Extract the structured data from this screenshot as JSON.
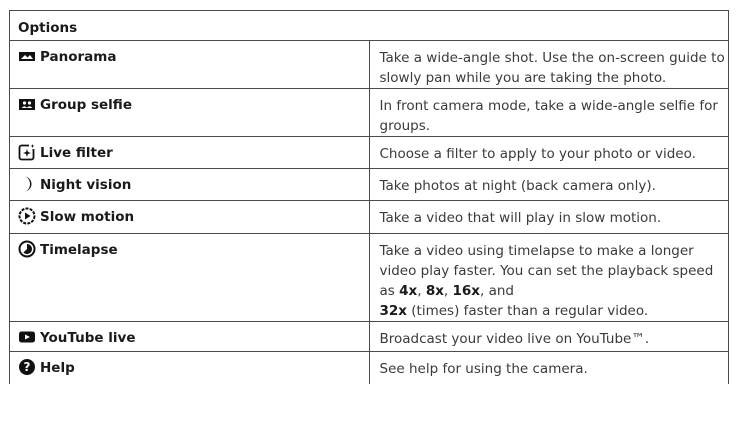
{
  "table": {
    "header": "Options",
    "rows": [
      {
        "icon": "panorama-icon",
        "label": "Panorama",
        "desc": "Take a wide-angle shot. Use the on-screen guide to slowly pan while you are taking the photo."
      },
      {
        "icon": "group-selfie-icon",
        "label": "Group selfie",
        "desc": "In front camera mode, take a wide-angle selfie for groups."
      },
      {
        "icon": "live-filter-icon",
        "label": "Live filter",
        "desc": "Choose a filter to apply to your photo or video."
      },
      {
        "icon": "night-vision-icon",
        "label": "Night vision",
        "desc": "Take photos at night (back camera only)."
      },
      {
        "icon": "slow-motion-icon",
        "label": "Slow motion",
        "desc": "Take a video that will play in slow motion."
      },
      {
        "icon": "timelapse-icon",
        "label": "Timelapse",
        "desc_parts": {
          "p1": "Take a video using timelapse to make a longer video play faster. You can set the playback speed as ",
          "s1": "4x",
          "c1": ", ",
          "s2": "8x",
          "c2": ", ",
          "s3": "16x",
          "c3": ", and ",
          "s4": "32x",
          "p2": " (times) faster than a regular video."
        }
      },
      {
        "icon": "youtube-icon",
        "label": "YouTube live",
        "desc": "Broadcast your video live on YouTube™."
      },
      {
        "icon": "help-icon",
        "label": "Help",
        "desc": "See help for using the camera."
      }
    ]
  }
}
